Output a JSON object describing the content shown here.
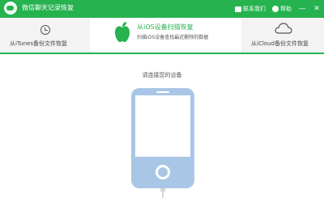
{
  "titlebar": {
    "app_title": "微信聊天记录恢复",
    "contact_label": "联系我们",
    "help_label": "帮助",
    "minimize_glyph": "—",
    "close_glyph": "✕"
  },
  "tabs": [
    {
      "label": "从iTunes备份文件恢复",
      "icon": "clock-icon"
    },
    {
      "label": "从iOS设备扫描恢复",
      "subtitle": "扫描iOS设备查找最近删除的数据",
      "icon": "apple-icon",
      "active": true
    },
    {
      "label": "从iCloud备份文件恢复",
      "icon": "cloud-icon"
    }
  ],
  "main": {
    "prompt": "请连接您的设备",
    "device_icon": "iphone-icon"
  },
  "colors": {
    "accent": "#25b24f",
    "phone_body": "#a9c6e6"
  }
}
